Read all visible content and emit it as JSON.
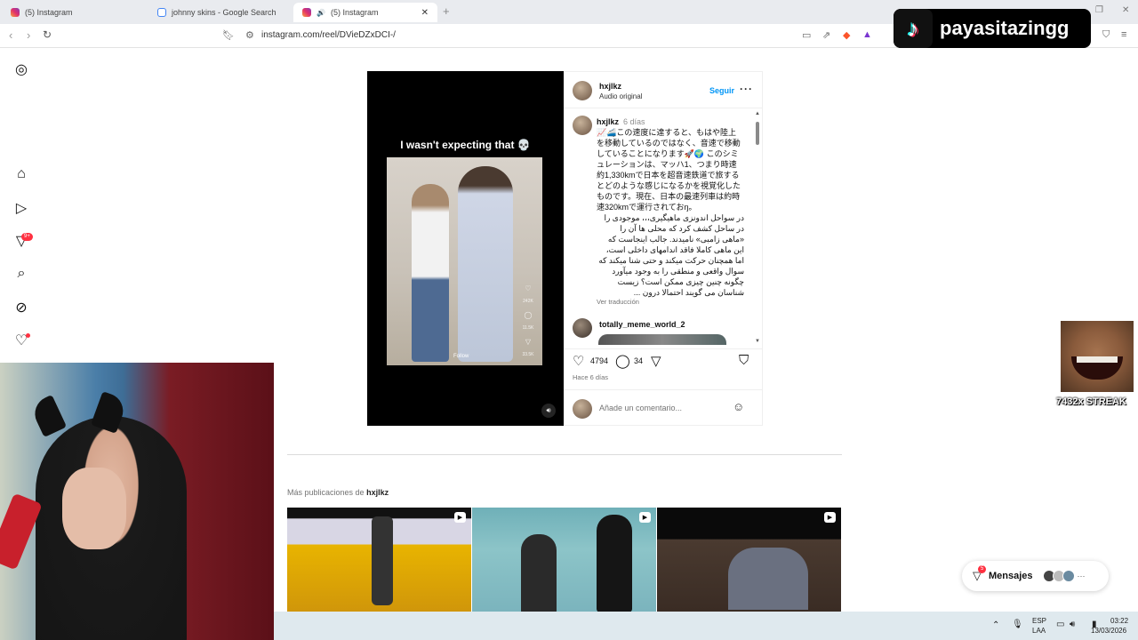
{
  "browser": {
    "tabs": [
      {
        "title": "(5) Instagram",
        "icon": "instagram-icon",
        "active": false
      },
      {
        "title": "johnny skins - Google Search",
        "icon": "google-icon",
        "active": false
      },
      {
        "title": "(5) Instagram",
        "icon": "instagram-icon",
        "active": true
      }
    ],
    "url": "instagram.com/reel/DVieDZxDCI-/"
  },
  "sidebar": {
    "notifications_badge": "9+"
  },
  "post": {
    "video_caption": "I wasn't expecting that",
    "video_side_counts": [
      "242K",
      "11.5K",
      "33.5K"
    ],
    "video_follow": "Follow",
    "username": "hxjlkz",
    "audio": "Audio original",
    "follow_label": "Seguir",
    "caption_user": "hxjlkz",
    "caption_time": "6 días",
    "caption_jp": "📈🚄この速度に達すると、もはや陸上を移動しているのではなく、音速で移動していることになります🚀🌍 このシミュレーションは、マッハ1、つまり時速約1,330kmで日本を超音速鉄道で旅するとどのような感じになるかを視覚化したものです。現在、日本の最速列車は約時速320kmで運行されておŋ。",
    "caption_fa": "در سواحل اندونزی ماهیگیری،،، موجودی را در ساحل کشف کرد که محلی ها آن را «ماهی زامبی» نامیدند. جالب اینجاست که این ماهی کاملا فاقد اندامهای داخلی است، اما همچنان حرکت میکند و حتی شنا میکند که سوال واقعی و منطقی را به وجود میآورد چگونه چنین چیزی ممکن است؟ زیست شناسان می گویند احتمالا درون ...",
    "translate": "Ver traducción",
    "comment_user": "totally_meme_world_2",
    "likes": "4794",
    "comments": "34",
    "posted": "Hace 6 días",
    "comment_placeholder": "Añade un comentario..."
  },
  "more_posts": {
    "label": "Más publicaciones de",
    "user": "hxjlkz"
  },
  "overlays": {
    "tiktok_name": "payasitazingg",
    "streak": "7432x STREAK",
    "messages_label": "Mensajes",
    "messages_badge": "5"
  },
  "taskbar": {
    "lang_1": "ESP",
    "lang_2": "LAA",
    "time": "03:22",
    "date": "13/03/2026"
  },
  "colors": {
    "accent": "#0095f6",
    "badge": "#ff3040",
    "tab_bar": "#e9ebef"
  }
}
